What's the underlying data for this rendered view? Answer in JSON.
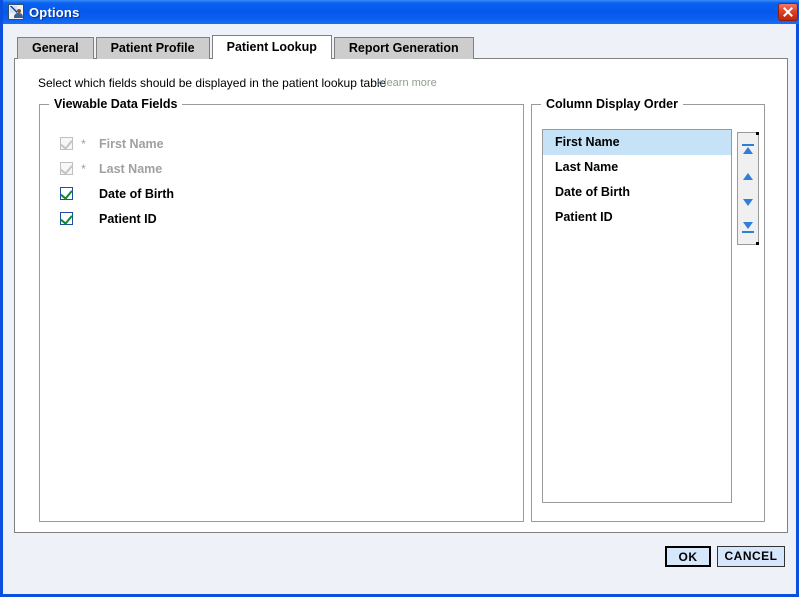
{
  "window": {
    "title": "Options",
    "icon": "chart-person-icon",
    "close_label": "close-icon",
    "accent_blue": "#0a4fe0",
    "panel_bg": "#eef1f7"
  },
  "tabs": [
    {
      "label": "General",
      "active": false
    },
    {
      "label": "Patient Profile",
      "active": false
    },
    {
      "label": "Patient Lookup",
      "active": true
    },
    {
      "label": "Report Generation",
      "active": false
    }
  ],
  "page": {
    "instruction": "Select which fields should be displayed in the patient lookup table",
    "learn_more": {
      "chevrons": "»",
      "label": "learn more",
      "color": "#8f9e8f"
    }
  },
  "viewable_fields": {
    "legend": "Viewable Data Fields",
    "items": [
      {
        "label": "First Name",
        "checked": true,
        "disabled": true,
        "required_marker": "*"
      },
      {
        "label": "Last Name",
        "checked": true,
        "disabled": true,
        "required_marker": "*"
      },
      {
        "label": "Date of Birth",
        "checked": true,
        "disabled": false,
        "required_marker": ""
      },
      {
        "label": "Patient ID",
        "checked": true,
        "disabled": false,
        "required_marker": ""
      }
    ],
    "check_color": "#0f8a2e",
    "box_border": "#1c4f9c"
  },
  "column_order": {
    "legend": "Column Display Order",
    "items": [
      {
        "label": "First Name",
        "selected": true
      },
      {
        "label": "Last Name",
        "selected": false
      },
      {
        "label": "Date of Birth",
        "selected": false
      },
      {
        "label": "Patient ID",
        "selected": false
      }
    ],
    "selection_color": "#c5e2f7",
    "buttons": [
      {
        "name": "move-to-top-button",
        "icon": "triangle-up-bar-icon"
      },
      {
        "name": "move-up-button",
        "icon": "triangle-up-icon"
      },
      {
        "name": "move-down-button",
        "icon": "triangle-down-icon"
      },
      {
        "name": "move-to-bottom-button",
        "icon": "triangle-down-bar-icon"
      }
    ]
  },
  "footer": {
    "ok_label": "OK",
    "cancel_label": "CANCEL"
  }
}
